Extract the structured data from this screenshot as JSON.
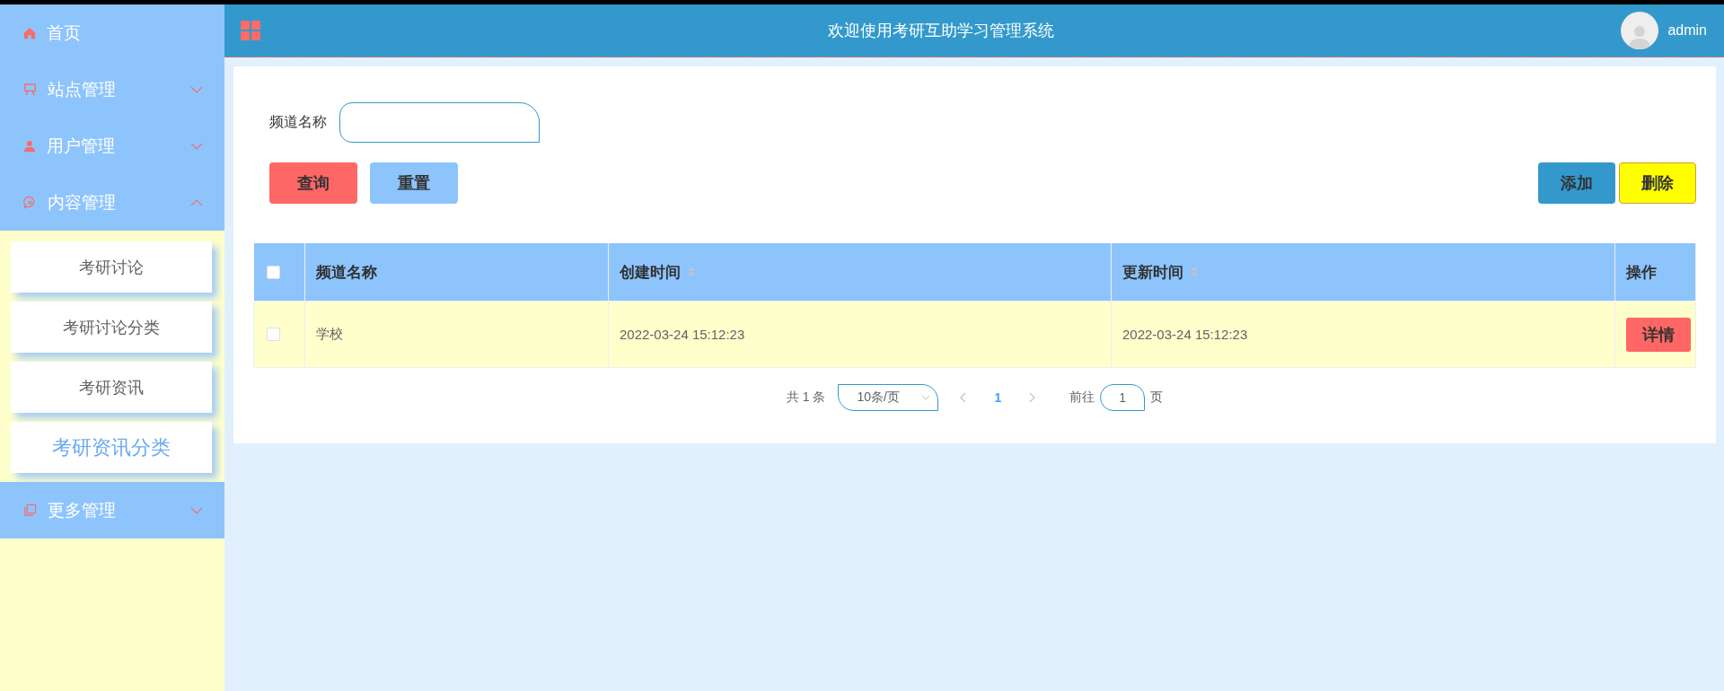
{
  "sidebar": {
    "items": [
      {
        "label": "首页",
        "expandable": false,
        "expanded": false
      },
      {
        "label": "站点管理",
        "expandable": true,
        "expanded": false
      },
      {
        "label": "用户管理",
        "expandable": true,
        "expanded": false
      },
      {
        "label": "内容管理",
        "expandable": true,
        "expanded": true,
        "children": [
          {
            "label": "考研讨论",
            "selected": false
          },
          {
            "label": "考研讨论分类",
            "selected": false
          },
          {
            "label": "考研资讯",
            "selected": false
          },
          {
            "label": "考研资讯分类",
            "selected": true
          }
        ]
      },
      {
        "label": "更多管理",
        "expandable": true,
        "expanded": false
      }
    ]
  },
  "header": {
    "title": "欢迎使用考研互助学习管理系统",
    "user": "admin"
  },
  "search": {
    "label": "频道名称"
  },
  "buttons": {
    "left": [
      "查询",
      "重置"
    ],
    "right": [
      "添加",
      "删除"
    ]
  },
  "table": {
    "all_checked": false,
    "columns": [
      {
        "label": "频道名称",
        "sortable": false
      },
      {
        "label": "创建时间",
        "sortable": true
      },
      {
        "label": "更新时间",
        "sortable": true
      },
      {
        "label": "操作",
        "sortable": false
      }
    ],
    "rows": [
      {
        "checked": false,
        "cells": [
          "学校",
          "2022-03-24 15:12:23",
          "2022-03-24 15:12:23"
        ],
        "action": "详情"
      }
    ]
  },
  "pagination": {
    "total": "共 1 条",
    "page_size": "10条/页",
    "pages": [
      {
        "label": "1",
        "selected": true
      }
    ],
    "goto_label": "前往",
    "goto_value": "1",
    "goto_suffix": "页"
  }
}
